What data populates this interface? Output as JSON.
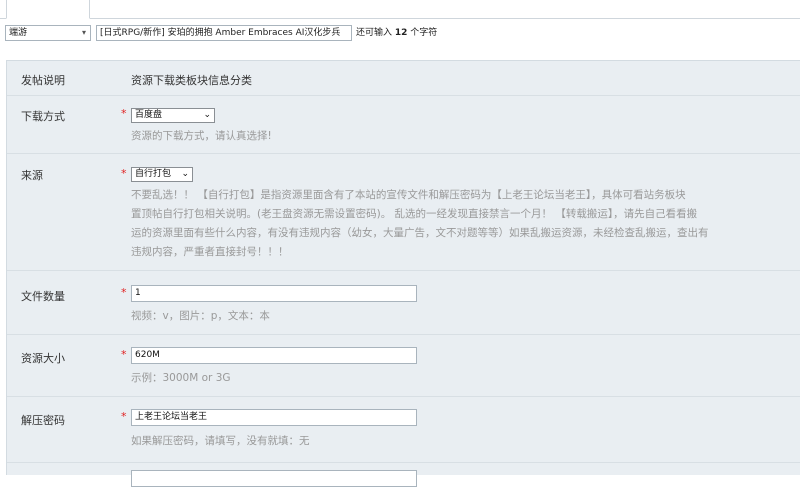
{
  "top": {
    "type_select": "端游",
    "title_value": "[日式RPG/新作] 安珀的拥抱 Amber Embraces AI汉化步兵",
    "remain_prefix": "还可输入",
    "remain_count": "12",
    "remain_suffix": "个字符"
  },
  "form": {
    "intro": {
      "label": "发帖说明",
      "value": "资源下载类板块信息分类"
    },
    "download": {
      "label": "下载方式",
      "selected": "百度盘",
      "hint": "资源的下载方式，请认真选择!"
    },
    "source": {
      "label": "来源",
      "selected": "自行打包",
      "hint_lines": [
        "不要乱选！！ 【自行打包】是指资源里面含有了本站的宣传文件和解压密码为【上老王论坛当老王】，具体可看站务板块",
        "置顶帖自行打包相关说明。(老王盘资源无需设置密码)。 乱选的一经发现直接禁言一个月！ 【转载搬运】，请先自己看看搬",
        "运的资源里面有些什么内容，有没有违规内容（幼女，大量广告，文不对题等等）如果乱搬运资源，未经检查乱搬运，查出有",
        "违规内容，严重者直接封号！！！"
      ]
    },
    "file_count": {
      "label": "文件数量",
      "value": "1",
      "hint": "视频：v，图片：p，文本：本"
    },
    "size": {
      "label": "资源大小",
      "value": "620M",
      "hint": "示例：3000M or 3G"
    },
    "password": {
      "label": "解压密码",
      "value": "上老王论坛当老王",
      "hint": "如果解压密码，请填写，没有就填：无"
    },
    "required_mark": "*"
  }
}
